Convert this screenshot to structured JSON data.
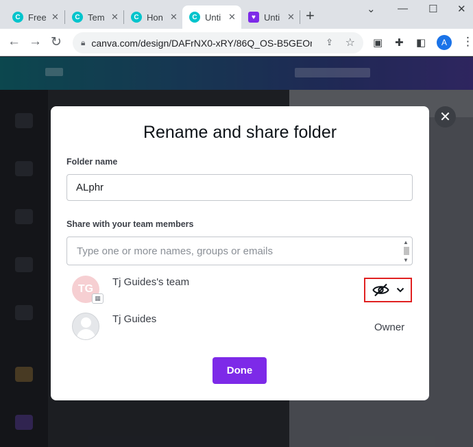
{
  "browser": {
    "tabs": [
      {
        "title": "Free",
        "favicon": "canva-icon",
        "active": false
      },
      {
        "title": "Tem",
        "favicon": "canva-icon",
        "active": false
      },
      {
        "title": "Hon",
        "favicon": "canva-icon",
        "active": false
      },
      {
        "title": "Unti",
        "favicon": "canva-icon",
        "active": true
      },
      {
        "title": "Unti",
        "favicon": "gift-icon",
        "active": false
      }
    ],
    "new_tab_label": "+",
    "url": "canva.com/design/DAFrNX0-xRY/86Q_OS-B5GEOn...",
    "profile_initial": "A"
  },
  "dialog": {
    "title": "Rename and share folder",
    "folder_name_label": "Folder name",
    "folder_name_value": "ALphr",
    "share_label": "Share with your team members",
    "share_placeholder": "Type one or more names, groups or emails",
    "members": [
      {
        "name": "Tj Guides's team",
        "initials": "TG",
        "permission_icon": "eye-off-icon"
      },
      {
        "name": "Tj Guides",
        "role": "Owner"
      }
    ],
    "done_label": "Done"
  },
  "colors": {
    "accent": "#7d2ae8",
    "highlight_border": "#e02020",
    "team_avatar": "#f6cfd2"
  }
}
